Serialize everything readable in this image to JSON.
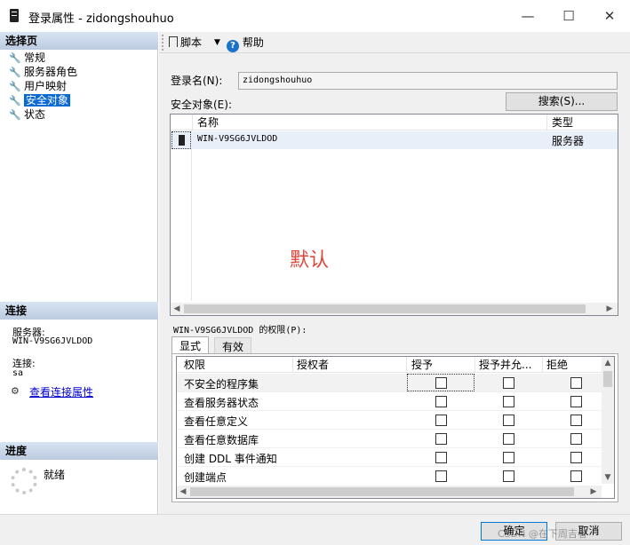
{
  "window": {
    "title": "登录属性 - zidongshouhuo",
    "minimize": "—",
    "maximize": "☐",
    "close": "✕"
  },
  "left": {
    "select_page_header": "选择页",
    "pages": [
      "常规",
      "服务器角色",
      "用户映射",
      "安全对象",
      "状态"
    ],
    "selected_index": 3,
    "connection_header": "连接",
    "server_label": "服务器:",
    "server_value": "WIN-V9SG6JVLDOD",
    "connection_label": "连接:",
    "connection_value": "sa",
    "view_props_link": "查看连接属性",
    "progress_header": "进度",
    "progress_status": "就绪"
  },
  "toolbar": {
    "script_label": "脚本",
    "help_label": "帮助"
  },
  "main": {
    "login_name_label": "登录名(N):",
    "login_name_value": "zidongshouhuo",
    "securables_label": "安全对象(E):",
    "search_button": "搜索(S)...",
    "securables_columns": [
      "名称",
      "类型"
    ],
    "securables_rows": [
      {
        "name": "WIN-V9SG6JVLDOD",
        "type": "服务器"
      }
    ],
    "watermark": "默认",
    "permissions_label": "WIN-V9SG6JVLDOD 的权限(P):",
    "tabs": [
      "显式",
      "有效"
    ],
    "active_tab": 0,
    "perm_columns": [
      "权限",
      "授权者",
      "授予",
      "授予并允...",
      "拒绝"
    ],
    "perm_rows": [
      {
        "permission": "不安全的程序集",
        "grantor": "",
        "grant": false,
        "with_grant": false,
        "deny": false
      },
      {
        "permission": "查看服务器状态",
        "grantor": "",
        "grant": false,
        "with_grant": false,
        "deny": false
      },
      {
        "permission": "查看任意定义",
        "grantor": "",
        "grant": false,
        "with_grant": false,
        "deny": false
      },
      {
        "permission": "查看任意数据库",
        "grantor": "",
        "grant": false,
        "with_grant": false,
        "deny": false
      },
      {
        "permission": "创建 DDL 事件通知",
        "grantor": "",
        "grant": false,
        "with_grant": false,
        "deny": false
      },
      {
        "permission": "创建端点",
        "grantor": "",
        "grant": false,
        "with_grant": false,
        "deny": false
      }
    ]
  },
  "footer": {
    "ok_button": "确定",
    "cancel_button": "取消",
    "overlay_text": "CSDN @在下周吉者"
  },
  "colors": {
    "selection": "#0b6ad2",
    "link": "#0000cc",
    "watermark": "#e0453a",
    "panel": "#f0f0f0"
  }
}
